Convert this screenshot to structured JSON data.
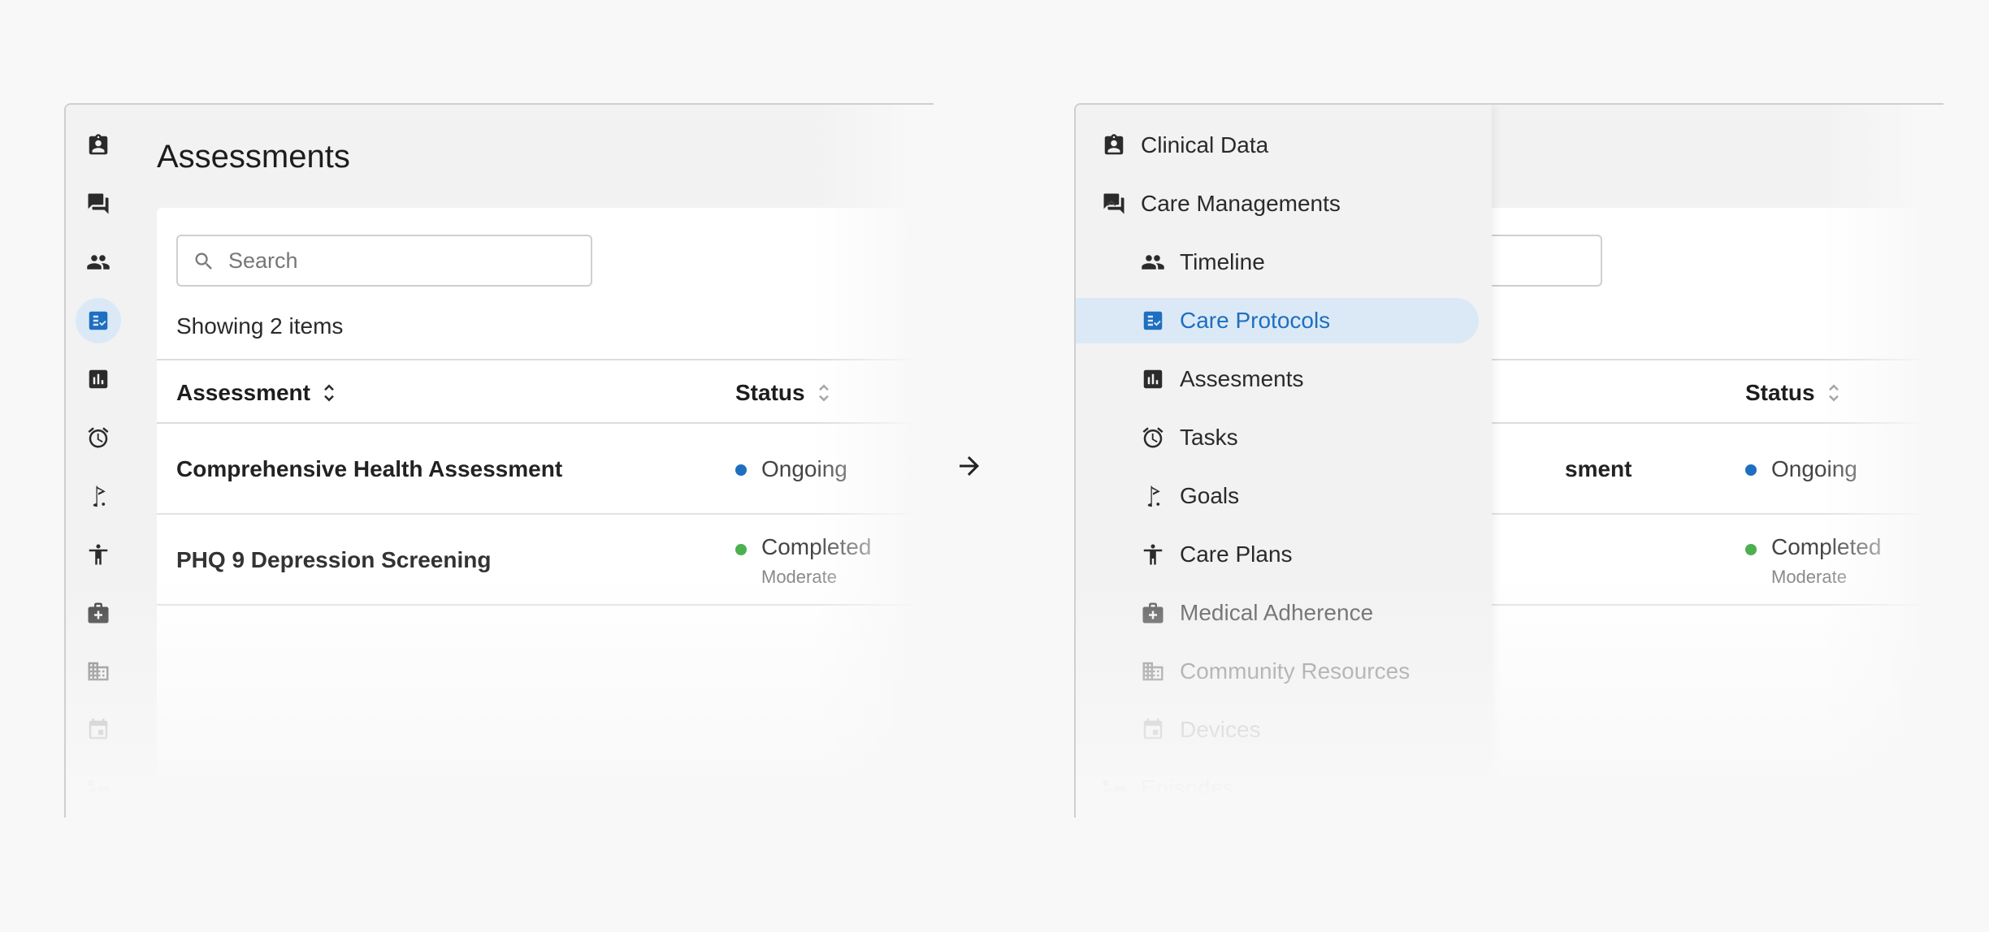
{
  "left": {
    "title": "Assessments",
    "search": {
      "placeholder": "Search",
      "value": ""
    },
    "showing": "Showing 2 items",
    "columns": {
      "assessment": "Assessment",
      "status": "Status"
    },
    "rows": [
      {
        "name": "Comprehensive Health Assessment",
        "status": "Ongoing",
        "status_color": "#1e6fc0",
        "sub": ""
      },
      {
        "name": "PHQ 9 Depression Screening",
        "status": "Completed",
        "status_color": "#4caf50",
        "sub": "Moderate"
      }
    ],
    "rail_icons": [
      "clinical-data-icon",
      "chat-icon",
      "people-icon",
      "checklist-icon",
      "chart-icon",
      "alarm-icon",
      "golf-flag-icon",
      "accessibility-icon",
      "medical-case-icon",
      "building-icon",
      "calendar-icon",
      "episodes-icon"
    ]
  },
  "right": {
    "bg": {
      "row1_partial": "sment",
      "status_header": "Status",
      "row1_status": "Ongoing",
      "row2_status": "Completed",
      "row2_sub": "Moderate"
    },
    "nav": [
      {
        "label": "Clinical Data",
        "icon": "clinical-data-icon",
        "level": "top"
      },
      {
        "label": "Care Managements",
        "icon": "chat-icon",
        "level": "top",
        "expanded": true
      },
      {
        "label": "Timeline",
        "icon": "people-icon",
        "level": "sub"
      },
      {
        "label": "Care Protocols",
        "icon": "checklist-icon",
        "level": "sub",
        "active": true
      },
      {
        "label": "Assesments",
        "icon": "chart-icon",
        "level": "sub"
      },
      {
        "label": "Tasks",
        "icon": "alarm-icon",
        "level": "sub"
      },
      {
        "label": "Goals",
        "icon": "golf-flag-icon",
        "level": "sub"
      },
      {
        "label": "Care Plans",
        "icon": "accessibility-icon",
        "level": "sub"
      },
      {
        "label": "Medical Adherence",
        "icon": "medical-case-icon",
        "level": "sub"
      },
      {
        "label": "Community Resources",
        "icon": "building-icon",
        "level": "sub"
      },
      {
        "label": "Devices",
        "icon": "calendar-icon",
        "level": "sub"
      },
      {
        "label": "Episodes",
        "icon": "episodes-icon",
        "level": "top"
      }
    ]
  },
  "colors": {
    "accent": "#1e6fc0",
    "active_bg": "#dbe9f7",
    "ongoing": "#1e6fc0",
    "completed": "#4caf50"
  }
}
